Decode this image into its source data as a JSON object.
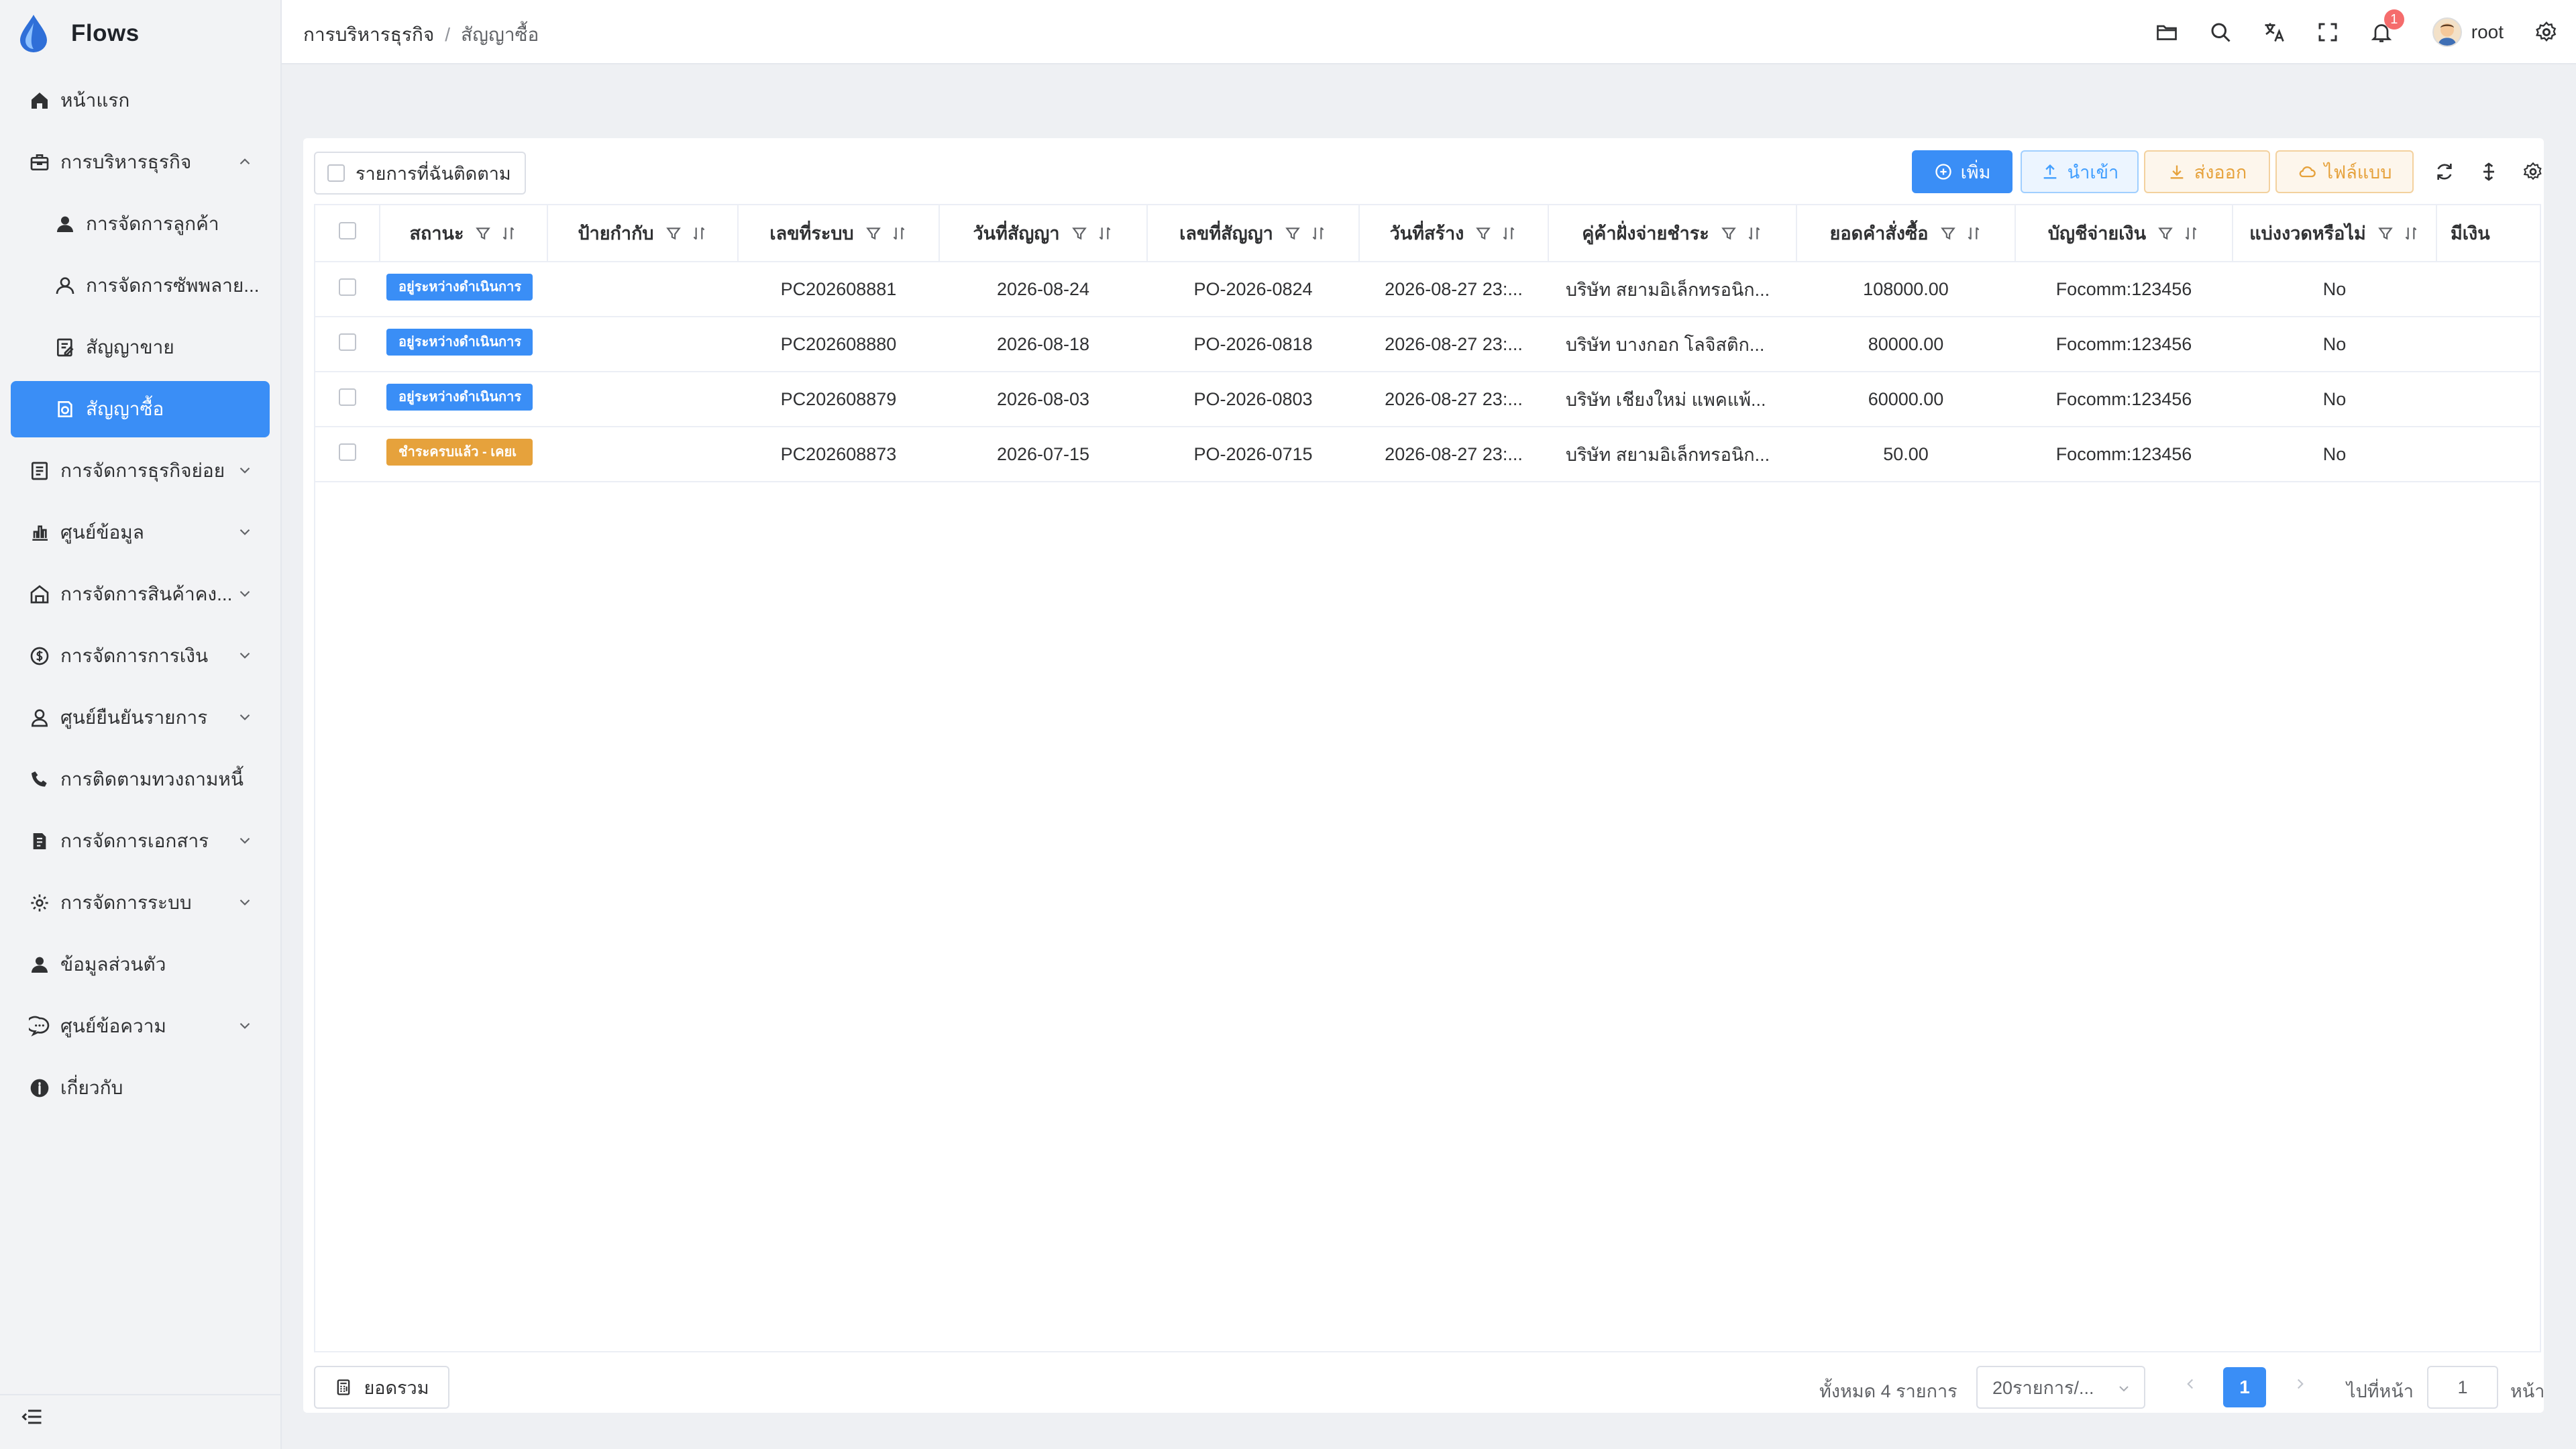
{
  "app": {
    "name": "Flows"
  },
  "sidebar": {
    "items": [
      {
        "label": "หน้าแรก",
        "icon": "home-icon"
      },
      {
        "label": "การบริหารธุรกิจ",
        "icon": "briefcase-icon",
        "expanded": true
      },
      {
        "label": "การจัดการลูกค้า",
        "icon": "user-icon",
        "sub": true
      },
      {
        "label": "การจัดการซัพพลาย...",
        "icon": "user-outline-icon",
        "sub": true
      },
      {
        "label": "สัญญาขาย",
        "icon": "contract-icon",
        "sub": true
      },
      {
        "label": "สัญญาซื้อ",
        "icon": "purchase-contract-icon",
        "sub": true,
        "active": true
      },
      {
        "label": "การจัดการธุรกิจย่อย",
        "icon": "document-icon"
      },
      {
        "label": "ศูนย์ข้อมูล",
        "icon": "bar-chart-icon"
      },
      {
        "label": "การจัดการสินค้าคง...",
        "icon": "warehouse-icon"
      },
      {
        "label": "การจัดการการเงิน",
        "icon": "money-icon"
      },
      {
        "label": "ศูนย์ยืนยันรายการ",
        "icon": "user-check-icon"
      },
      {
        "label": "การติดตามทวงถามหนี้",
        "icon": "phone-icon"
      },
      {
        "label": "การจัดการเอกสาร",
        "icon": "file-icon"
      },
      {
        "label": "การจัดการระบบ",
        "icon": "gear-icon"
      },
      {
        "label": "ข้อมูลส่วนตัว",
        "icon": "person-icon"
      },
      {
        "label": "ศูนย์ข้อความ",
        "icon": "chat-icon"
      },
      {
        "label": "เกี่ยวกับ",
        "icon": "info-icon"
      }
    ]
  },
  "header": {
    "breadcrumb": [
      "การบริหารธุรกิจ",
      "สัญญาซื้อ"
    ],
    "notification_count": "1",
    "user_name": "root"
  },
  "toolbar": {
    "follow_label": "รายการที่ฉันติดตาม",
    "add_label": "เพิ่ม",
    "import_label": "นำเข้า",
    "export_label": "ส่งออก",
    "template_label": "ไฟล์แบบ"
  },
  "table": {
    "columns": [
      "สถานะ",
      "ป้ายกำกับ",
      "เลขที่ระบบ",
      "วันที่สัญญา",
      "เลขที่สัญญา",
      "วันที่สร้าง",
      "คู่ค้าฝั่งจ่ายชำระ",
      "ยอดคำสั่งซื้อ",
      "บัญชีจ่ายเงิน",
      "แบ่งงวดหรือไม่",
      "มีเงิน"
    ],
    "rows": [
      {
        "status": "อยู่ระหว่างดำเนินการ",
        "status_color": "#3a8ef6",
        "tag": "",
        "system_no": "PC202608881",
        "contract_date": "2026-08-24",
        "contract_no": "PO-2026-0824",
        "created": "2026-08-27 23:...",
        "partner": "บริษัท สยามอิเล็กทรอนิก...",
        "amount": "108000.00",
        "account": "Focomm:123456",
        "installment": "No"
      },
      {
        "status": "อยู่ระหว่างดำเนินการ",
        "status_color": "#3a8ef6",
        "tag": "",
        "system_no": "PC202608880",
        "contract_date": "2026-08-18",
        "contract_no": "PO-2026-0818",
        "created": "2026-08-27 23:...",
        "partner": "บริษัท บางกอก โลจิสติก...",
        "amount": "80000.00",
        "account": "Focomm:123456",
        "installment": "No"
      },
      {
        "status": "อยู่ระหว่างดำเนินการ",
        "status_color": "#3a8ef6",
        "tag": "",
        "system_no": "PC202608879",
        "contract_date": "2026-08-03",
        "contract_no": "PO-2026-0803",
        "created": "2026-08-27 23:...",
        "partner": "บริษัท เชียงใหม่ แพคแพ้...",
        "amount": "60000.00",
        "account": "Focomm:123456",
        "installment": "No"
      },
      {
        "status": "ชำระครบแล้ว - เคยเ",
        "status_color": "#e6a23c",
        "tag": "",
        "system_no": "PC202608873",
        "contract_date": "2026-07-15",
        "contract_no": "PO-2026-0715",
        "created": "2026-08-27 23:...",
        "partner": "บริษัท สยามอิเล็กทรอนิก...",
        "amount": "50.00",
        "account": "Focomm:123456",
        "installment": "No"
      }
    ]
  },
  "footer": {
    "summary_label": "ยอดรวม",
    "total_text": "ทั้งหมด 4 รายการ",
    "page_size": "20รายการ/...",
    "current_page": "1",
    "goto_label": "ไปที่หน้า",
    "goto_value": "1",
    "goto_suffix": "หน้า"
  }
}
